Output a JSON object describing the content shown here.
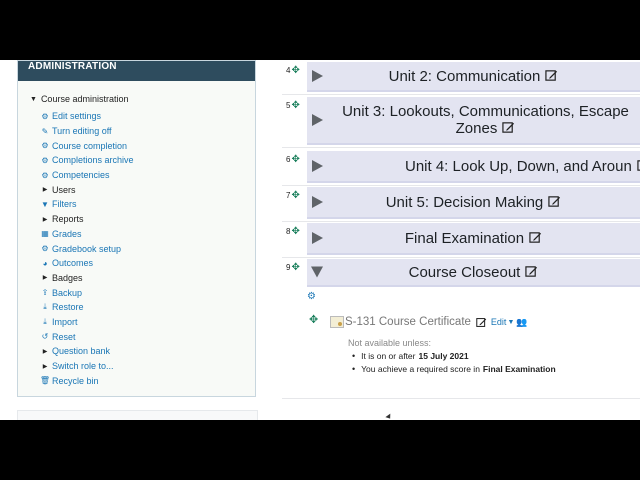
{
  "admin": {
    "title": "ADMINISTRATION",
    "root_label": "Course administration",
    "items": [
      {
        "label": "Edit settings",
        "icon": "gear-icon",
        "glyph": "⚙",
        "link": true
      },
      {
        "label": "Turn editing off",
        "icon": "pencil-icon",
        "glyph": "✎",
        "link": true
      },
      {
        "label": "Course completion",
        "icon": "gear-icon",
        "glyph": "⚙",
        "link": true
      },
      {
        "label": "Completions archive",
        "icon": "gear-icon",
        "glyph": "⚙",
        "link": true
      },
      {
        "label": "Competencies",
        "icon": "gear-icon",
        "glyph": "⚙",
        "link": true
      },
      {
        "label": "Users",
        "icon": "triangle-right-icon",
        "glyph": "▶",
        "link": false
      },
      {
        "label": "Filters",
        "icon": "filter-icon",
        "glyph": "▼",
        "link": true
      },
      {
        "label": "Reports",
        "icon": "triangle-right-icon",
        "glyph": "▶",
        "link": false
      },
      {
        "label": "Grades",
        "icon": "table-icon",
        "glyph": "▦",
        "link": true
      },
      {
        "label": "Gradebook setup",
        "icon": "gear-icon",
        "glyph": "⚙",
        "link": true
      },
      {
        "label": "Outcomes",
        "icon": "pie-icon",
        "glyph": "◕",
        "link": true
      },
      {
        "label": "Badges",
        "icon": "triangle-right-icon",
        "glyph": "▶",
        "link": false
      },
      {
        "label": "Backup",
        "icon": "upload-icon",
        "glyph": "⇪",
        "link": true
      },
      {
        "label": "Restore",
        "icon": "download-icon",
        "glyph": "⤓",
        "link": true
      },
      {
        "label": "Import",
        "icon": "download-icon",
        "glyph": "⤓",
        "link": true
      },
      {
        "label": "Reset",
        "icon": "undo-icon",
        "glyph": "↺",
        "link": true
      },
      {
        "label": "Question bank",
        "icon": "triangle-right-icon",
        "glyph": "▶",
        "link": true
      },
      {
        "label": "Switch role to...",
        "icon": "triangle-right-icon",
        "glyph": "▶",
        "link": true
      },
      {
        "label": "Recycle bin",
        "icon": "trash-icon",
        "glyph": "🗑",
        "link": true
      }
    ]
  },
  "sections": [
    {
      "num": "4",
      "title": "Unit 2: Communication",
      "line2": ""
    },
    {
      "num": "5",
      "title": "Unit 3: Lookouts, Communications, Escape",
      "line2": "Zones"
    },
    {
      "num": "6",
      "title": "Unit 4: Look Up, Down, and Aroun",
      "line2": ""
    },
    {
      "num": "7",
      "title": "Unit 5: Decision Making",
      "line2": ""
    },
    {
      "num": "8",
      "title": "Final Examination",
      "line2": ""
    },
    {
      "num": "9",
      "title": "Course Closeout",
      "line2": ""
    }
  ],
  "closeout": {
    "activity_title": "S-131 Course Certificate",
    "edit_label": "Edit",
    "not_available": "Not available unless:",
    "cond1_text": "It is on or after",
    "cond1_date": "15 July 2021",
    "cond2_text": "You achieve a required score in",
    "cond2_item": "Final Examination"
  },
  "colors": {
    "admin_header": "#2e4c5e",
    "section_bar": "#e3e4f1",
    "link": "#1a76b5",
    "move_icon": "#1a7f5c"
  }
}
